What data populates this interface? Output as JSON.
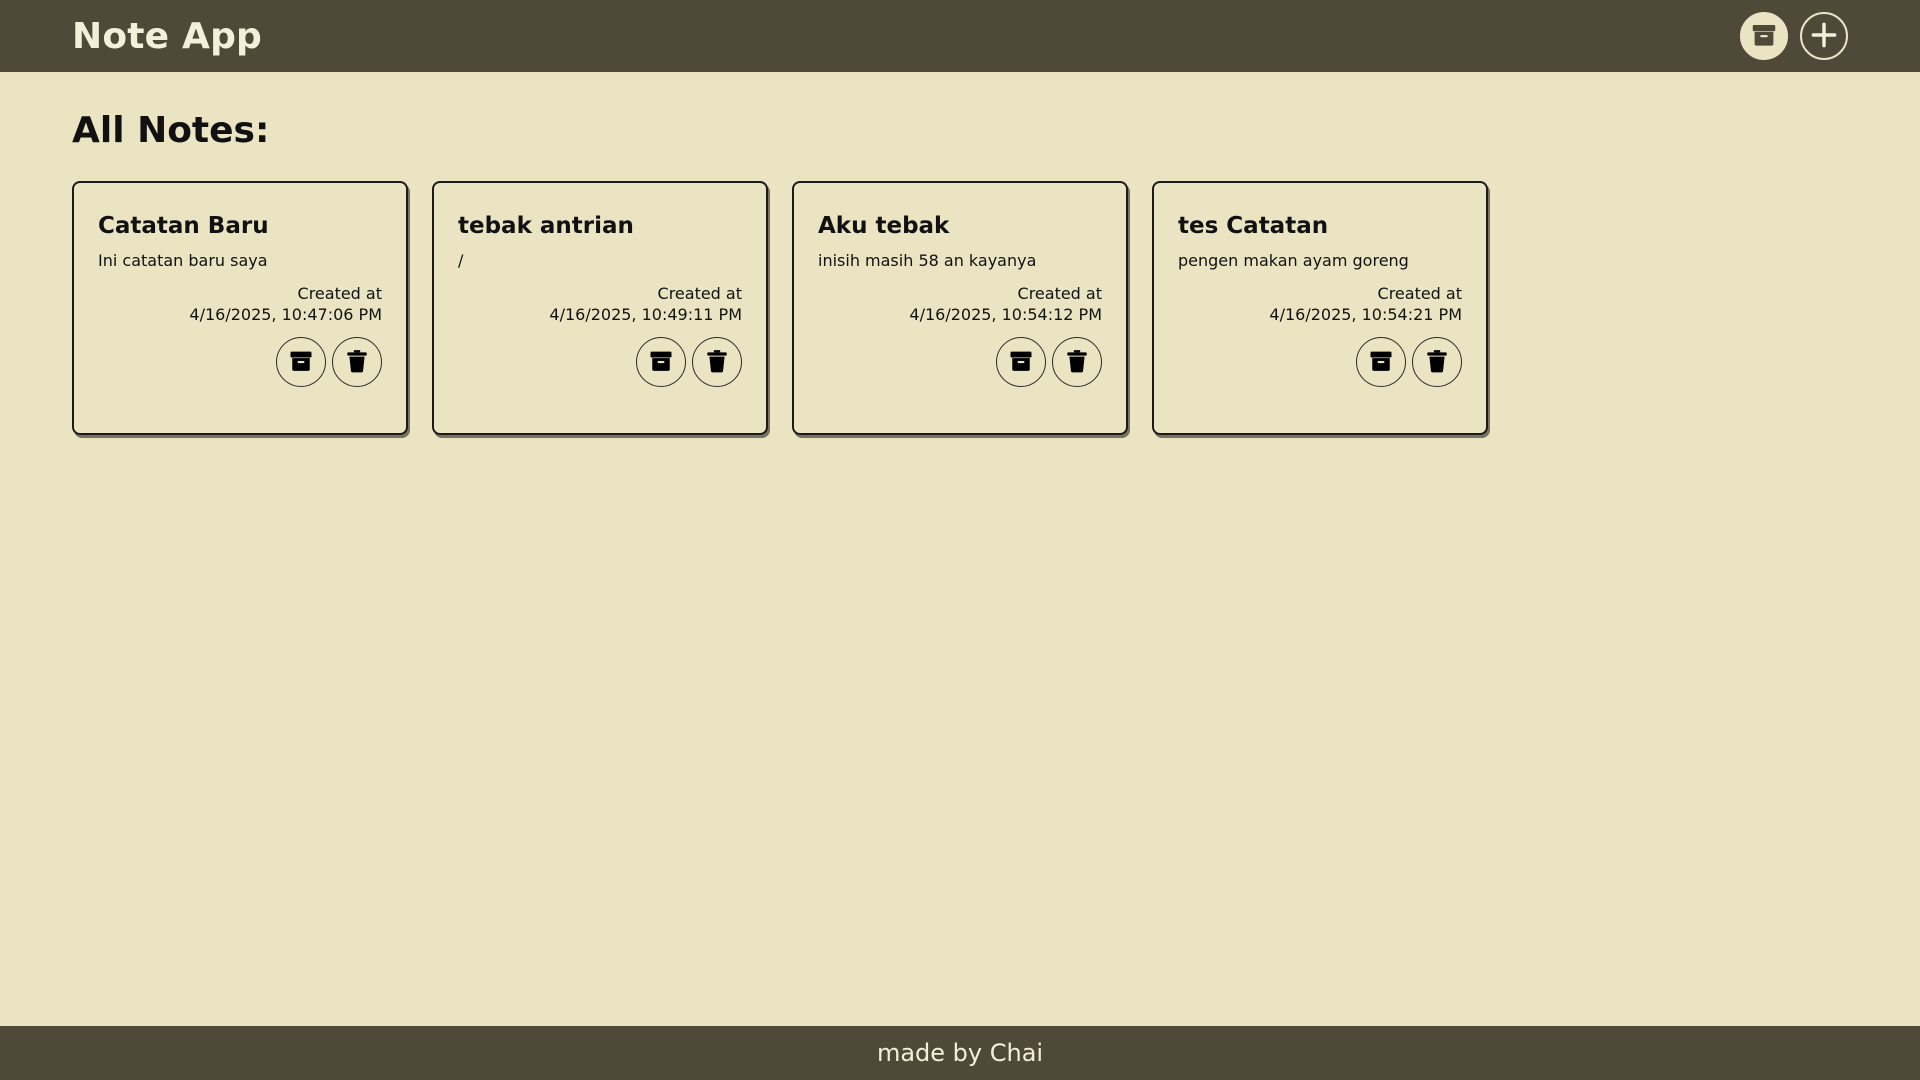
{
  "app": {
    "title": "Note App"
  },
  "header": {
    "archive_icon": "archive-icon",
    "add_icon": "plus-icon"
  },
  "main": {
    "section_title": "All Notes:"
  },
  "notes": [
    {
      "title": "Catatan Baru",
      "body": "Ini catatan baru saya",
      "created_label": "Created at",
      "created_at": "4/16/2025, 10:47:06 PM"
    },
    {
      "title": "tebak antrian",
      "body": "/",
      "created_label": "Created at",
      "created_at": "4/16/2025, 10:49:11 PM"
    },
    {
      "title": "Aku tebak",
      "body": "inisih masih 58 an kayanya",
      "created_label": "Created at",
      "created_at": "4/16/2025, 10:54:12 PM"
    },
    {
      "title": "tes Catatan",
      "body": "pengen makan ayam goreng",
      "created_label": "Created at",
      "created_at": "4/16/2025, 10:54:21 PM"
    }
  ],
  "footer": {
    "text": "made by Chai"
  },
  "colors": {
    "header_bg": "#4f4a38",
    "page_bg": "#ebe4c2",
    "text": "#111111",
    "header_text": "#f4efd8"
  }
}
